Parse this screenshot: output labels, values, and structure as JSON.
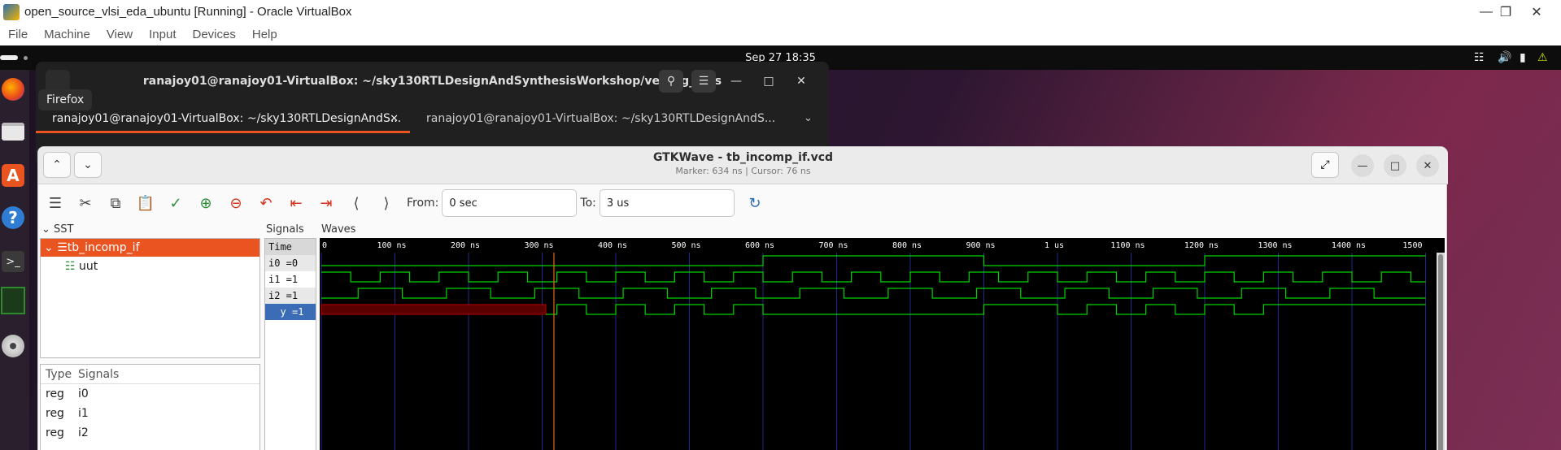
{
  "vbox": {
    "title": "open_source_vlsi_eda_ubuntu [Running] - Oracle VirtualBox",
    "menu": [
      "File",
      "Machine",
      "View",
      "Input",
      "Devices",
      "Help"
    ]
  },
  "gnome": {
    "clock": "Sep 27  18:35",
    "tooltip": "Firefox"
  },
  "terminal": {
    "title": "ranajoy01@ranajoy01-VirtualBox: ~/sky130RTLDesignAndSynthesisWorkshop/verilog_files",
    "tabs": [
      {
        "label": "ranajoy01@ranajoy01-VirtualBox: ~/sky130RTLDesignAndS...",
        "active": true
      },
      {
        "label": "ranajoy01@ranajoy01-VirtualBox: ~/sky130RTLDesignAndS...",
        "active": false
      }
    ]
  },
  "gtkwave": {
    "title": "GTKWave - tb_incomp_if.vcd",
    "subtitle": "Marker: 634 ns  |  Cursor: 76 ns",
    "from_label": "From:",
    "from_value": "0 sec",
    "to_label": "To:",
    "to_value": "3 us",
    "sst_label": "SST",
    "tree_root": "tb_incomp_if",
    "tree_child": "uut",
    "list_headers": [
      "Type",
      "Signals"
    ],
    "list_rows": [
      {
        "type": "reg",
        "name": "i0"
      },
      {
        "type": "reg",
        "name": "i1"
      },
      {
        "type": "reg",
        "name": "i2"
      }
    ],
    "signals_label": "Signals",
    "signals": [
      "Time",
      "i0 =0",
      "i1 =1",
      "i2 =1",
      "y =1"
    ],
    "waves_label": "Waves",
    "time_ticks": [
      "0",
      "100 ns",
      "200 ns",
      "300 ns",
      "400 ns",
      "500 ns",
      "600 ns",
      "700 ns",
      "800 ns",
      "900 ns",
      "1 us",
      "1100 ns",
      "1200 ns",
      "1300 ns",
      "1400 ns",
      "1500"
    ],
    "colors": {
      "wave": "#00d400",
      "background": "#000000",
      "marker": "#e9671c",
      "selection": "#3a6db5",
      "accent": "#e95420"
    }
  }
}
